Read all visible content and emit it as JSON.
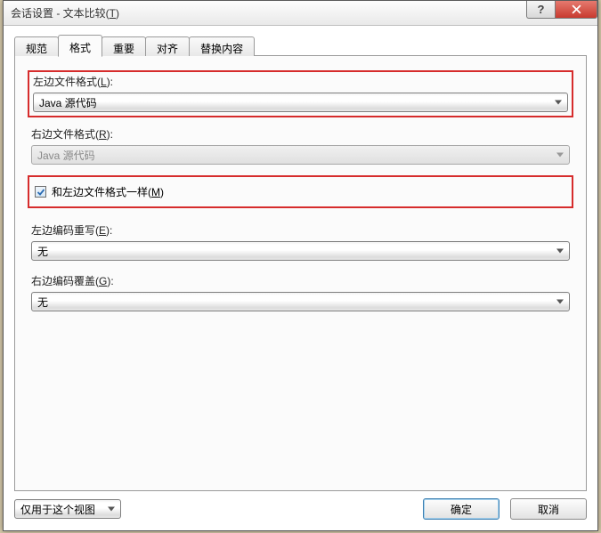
{
  "window": {
    "title_prefix": "会话设置 - 文本比较(",
    "title_hotkey": "T",
    "title_suffix": ")"
  },
  "tabs": [
    {
      "label": "规范"
    },
    {
      "label": "格式",
      "active": true
    },
    {
      "label": "重要"
    },
    {
      "label": "对齐"
    },
    {
      "label": "替换内容"
    }
  ],
  "left_format": {
    "label_prefix": "左边文件格式(",
    "label_hotkey": "L",
    "label_suffix": "):",
    "value": "Java 源代码"
  },
  "right_format": {
    "label_prefix": "右边文件格式(",
    "label_hotkey": "R",
    "label_suffix": "):",
    "value": "Java 源代码"
  },
  "same_as_left": {
    "label_prefix": "和左边文件格式一样(",
    "label_hotkey": "M",
    "label_suffix": ")",
    "checked": true
  },
  "left_encoding": {
    "label_prefix": "左边编码重写(",
    "label_hotkey": "E",
    "label_suffix": "):",
    "value": "无"
  },
  "right_encoding": {
    "label_prefix": "右边编码覆盖(",
    "label_hotkey": "G",
    "label_suffix": "):",
    "value": "无"
  },
  "footer": {
    "scope": "仅用于这个视图",
    "ok": "确定",
    "cancel": "取消"
  }
}
